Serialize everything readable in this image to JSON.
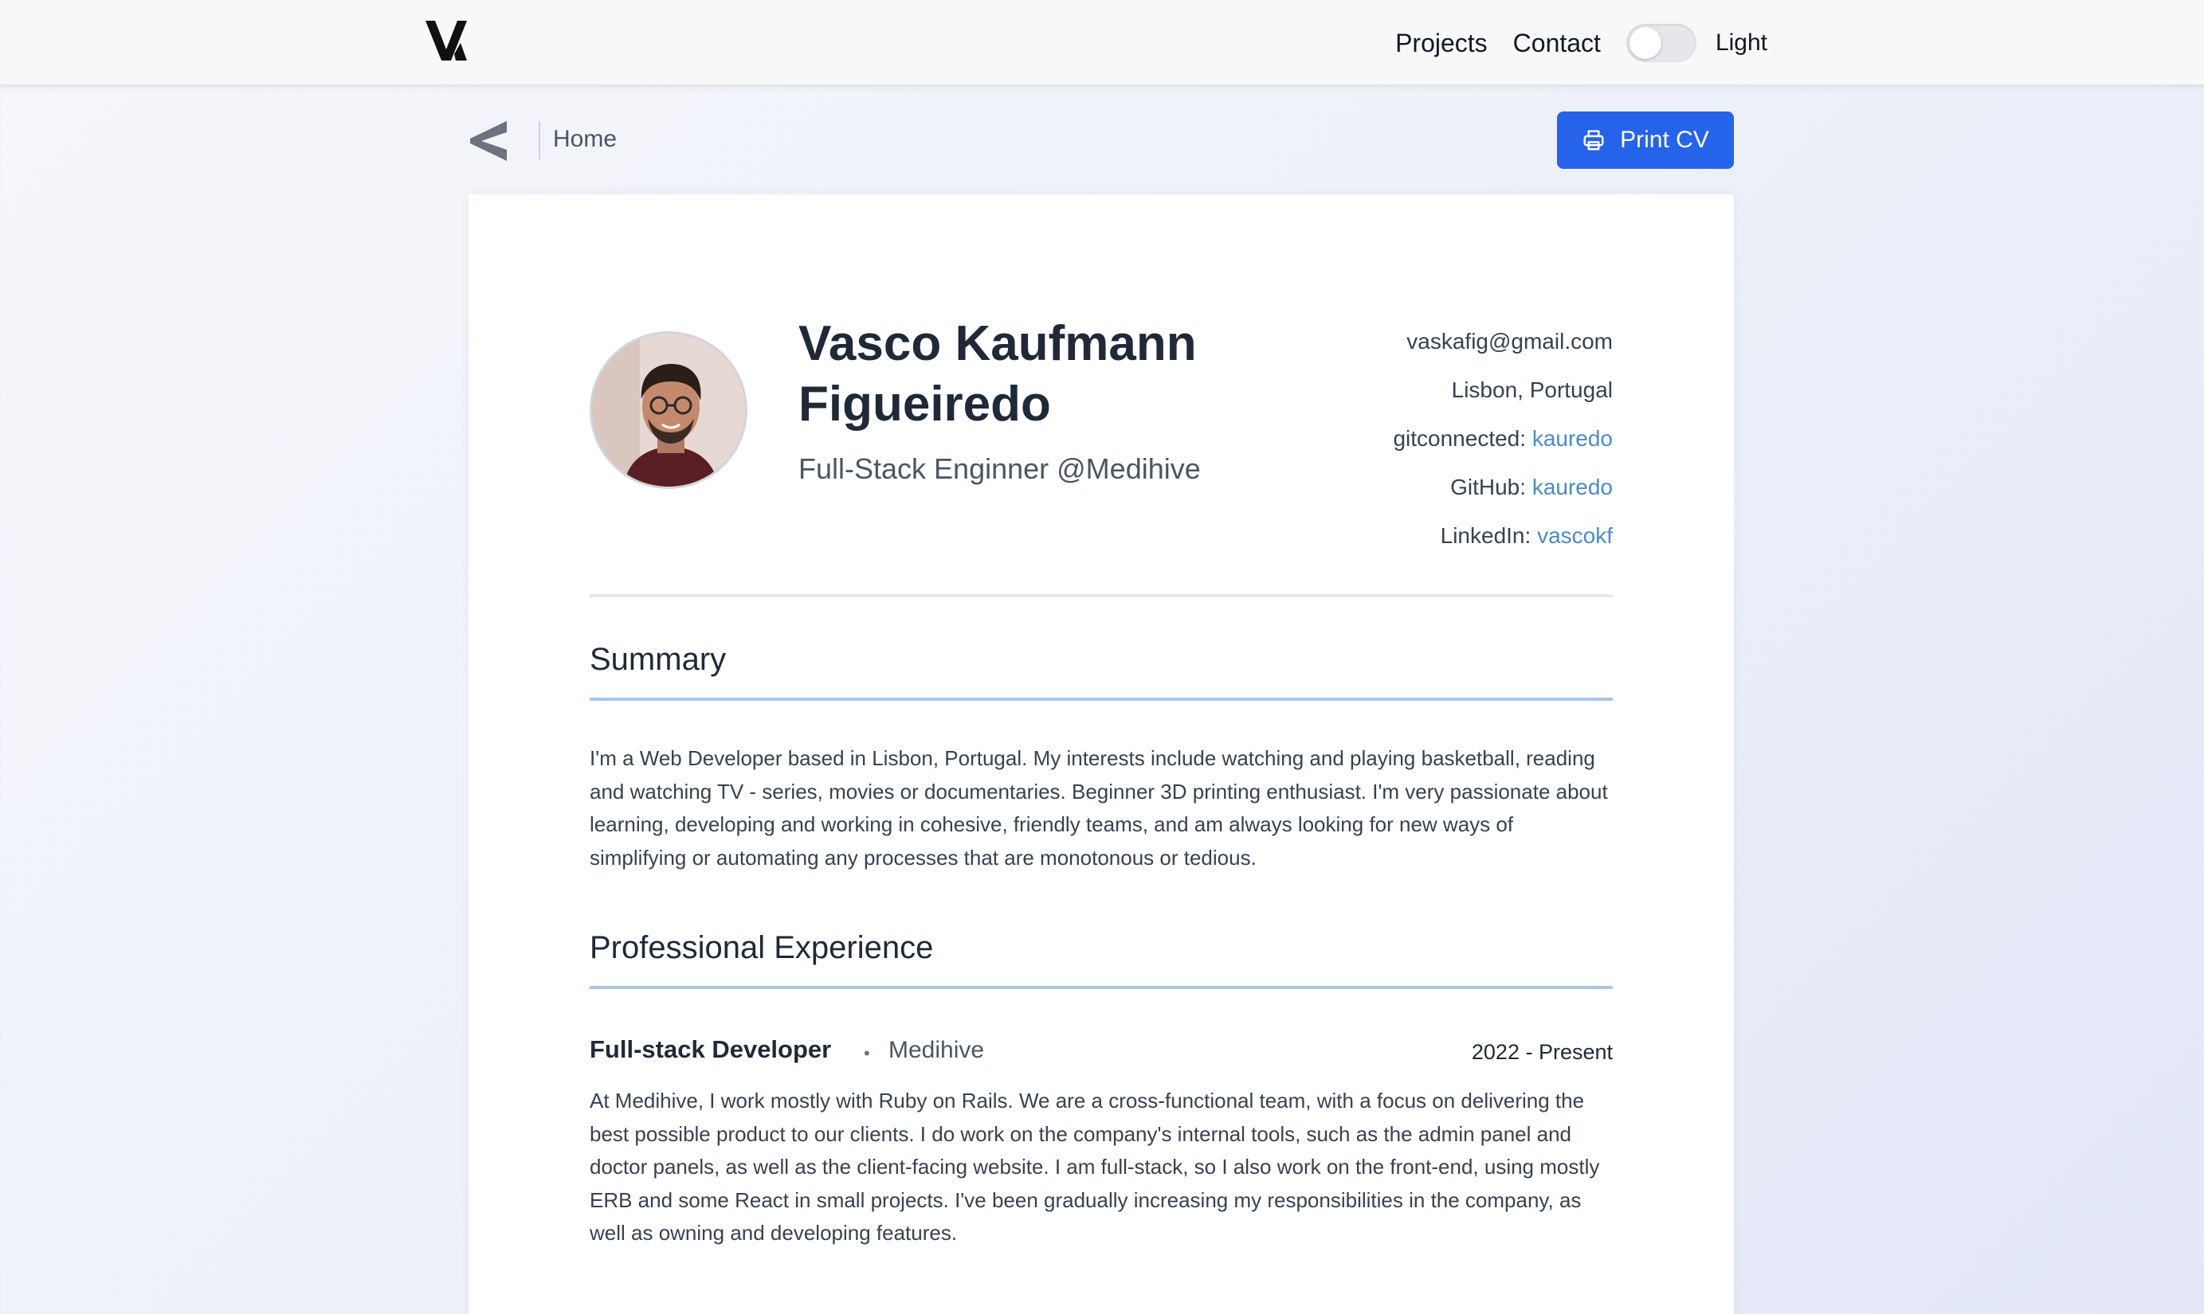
{
  "nav": {
    "links": [
      "Projects",
      "Contact"
    ],
    "theme_label": "Light"
  },
  "subheader": {
    "breadcrumb": "Home",
    "print_label": "Print CV"
  },
  "profile": {
    "name": "Vasco Kaufmann Figueiredo",
    "title": "Full-Stack Enginner @Medihive",
    "email": "vaskafig@gmail.com",
    "location": "Lisbon, Portugal",
    "links": [
      {
        "label": "gitconnected: ",
        "value": "kauredo"
      },
      {
        "label": "GitHub: ",
        "value": "kauredo"
      },
      {
        "label": "LinkedIn: ",
        "value": "vascokf"
      }
    ]
  },
  "summary": {
    "heading": "Summary",
    "text": "I'm a Web Developer based in Lisbon, Portugal. My interests include watching and playing basketball, reading and watching TV - series, movies or documentaries. Beginner 3D printing enthusiast. I'm very passionate about learning, developing and working in cohesive, friendly teams, and am always looking for new ways of simplifying or automating any processes that are monotonous or tedious."
  },
  "experience": {
    "heading": "Professional Experience",
    "jobs": [
      {
        "title": "Full-stack Developer",
        "separator": "•",
        "company": "Medihive",
        "dates": "2022 - Present",
        "description": "At Medihive, I work mostly with Ruby on Rails. We are a cross-functional team, with a focus on delivering the best possible product to our clients. I do work on the company's internal tools, such as the admin panel and doctor panels, as well as the client-facing website. I am full-stack, so I also work on the front-end, using mostly ERB and some React in small projects. I've been gradually increasing my responsibilities in the company, as well as owning and developing features."
      }
    ]
  },
  "colors": {
    "accent": "#2563eb",
    "link": "#4a8bc9",
    "section_rule": "#a9c7e4"
  },
  "icons": {
    "logo": "v-logo-icon",
    "back": "back-chevron-icon",
    "print": "printer-icon"
  }
}
